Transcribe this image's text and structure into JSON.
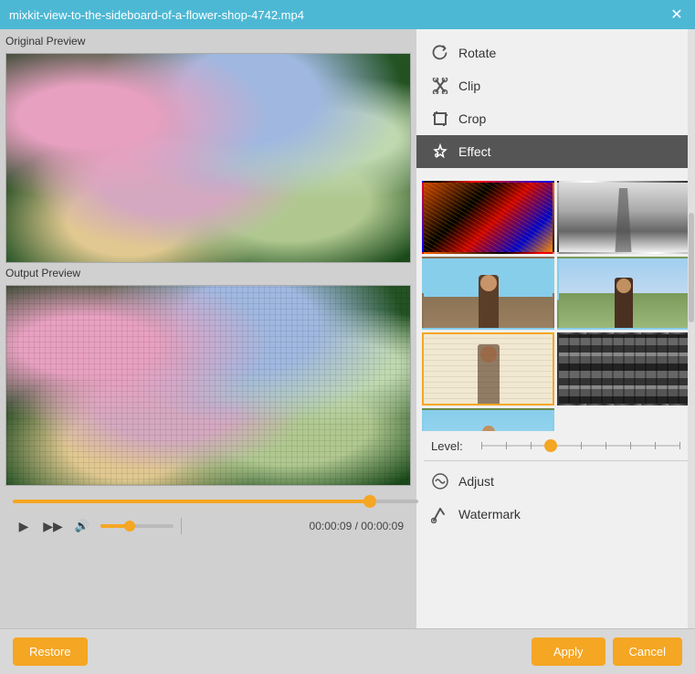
{
  "titleBar": {
    "title": "mixkit-view-to-the-sideboard-of-a-flower-shop-4742.mp4",
    "closeBtn": "✕"
  },
  "leftPanel": {
    "originalPreviewLabel": "Original Preview",
    "outputPreviewLabel": "Output Preview"
  },
  "rightPanel": {
    "tools": [
      {
        "id": "rotate",
        "label": "Rotate",
        "icon": "rotate"
      },
      {
        "id": "clip",
        "label": "Clip",
        "icon": "clip"
      },
      {
        "id": "crop",
        "label": "Crop",
        "icon": "crop"
      },
      {
        "id": "effect",
        "label": "Effect",
        "icon": "effect",
        "active": true
      }
    ],
    "levelLabel": "Level:",
    "bottomTools": [
      {
        "id": "adjust",
        "label": "Adjust",
        "icon": "adjust"
      },
      {
        "id": "watermark",
        "label": "Watermark",
        "icon": "watermark"
      }
    ]
  },
  "videoControls": {
    "currentTime": "00:00:09",
    "totalTime": "00:00:09",
    "timeSeparator": " / "
  },
  "bottomBar": {
    "restoreLabel": "Restore",
    "applyLabel": "Apply",
    "cancelLabel": "Cancel"
  }
}
